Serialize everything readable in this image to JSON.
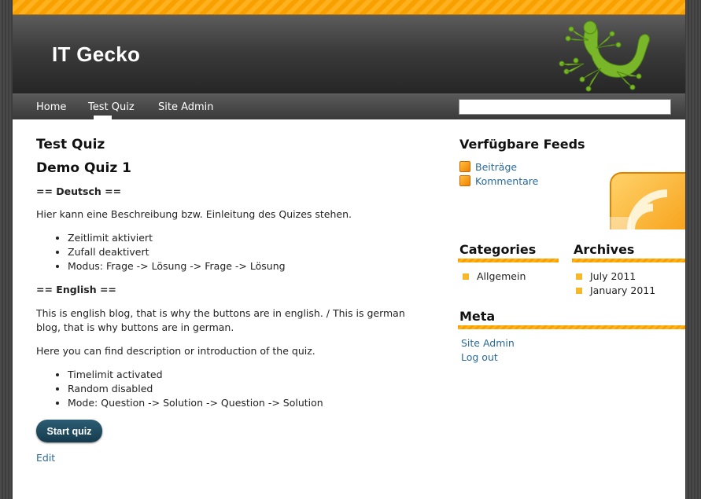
{
  "site": {
    "title": "IT Gecko"
  },
  "nav": {
    "items": [
      {
        "label": "Home"
      },
      {
        "label": "Test Quiz"
      },
      {
        "label": "Site Admin"
      }
    ],
    "search": {
      "value": "",
      "placeholder": ""
    }
  },
  "main": {
    "page_title": "Test Quiz",
    "post_title": "Demo Quiz 1",
    "de_heading": "== Deutsch ==",
    "de_intro": "Hier kann eine Beschreibung bzw. Einleitung des Quizes stehen.",
    "de_list": [
      "Zeitlimit aktiviert",
      "Zufall deaktivert",
      "Modus: Frage -> Lösung -> Frage -> Lösung"
    ],
    "en_heading": "== English ==",
    "en_note": "This is english blog, that is why the buttons are in english. / This is german blog, that is why buttons are in german.",
    "en_intro": "Here you can find description or introduction of the quiz.",
    "en_list": [
      "Timelimit activated",
      "Random disabled",
      "Mode: Question -> Solution -> Question -> Solution"
    ],
    "start_button": "Start quiz",
    "edit_link": "Edit"
  },
  "sidebar": {
    "feeds": {
      "title": "Verfügbare Feeds",
      "items": [
        "Beiträge",
        "Kommentare"
      ]
    },
    "categories": {
      "title": "Categories",
      "items": [
        "Allgemein"
      ]
    },
    "archives": {
      "title": "Archives",
      "items": [
        "July 2011",
        "January 2011"
      ]
    },
    "meta": {
      "title": "Meta",
      "items": [
        "Site Admin",
        "Log out"
      ]
    }
  },
  "colors": {
    "accent_orange": "#f8a000",
    "link_blue": "#2a6a9a",
    "button_teal": "#163b4c",
    "header_dark": "#262626"
  },
  "icons": [
    "gecko-logo-icon",
    "rss-feed-icon",
    "rss-large-icon",
    "square-bullet-icon"
  ]
}
